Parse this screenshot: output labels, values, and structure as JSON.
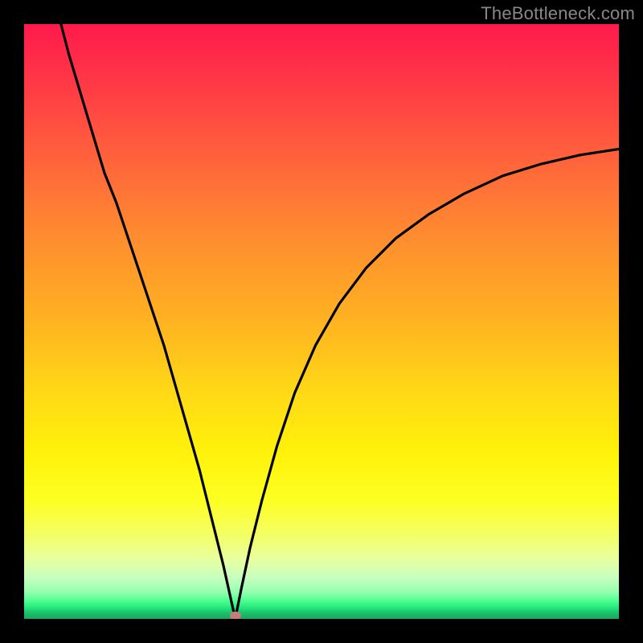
{
  "attribution": "TheBottleneck.com",
  "colors": {
    "page_bg": "#000000",
    "curve_stroke": "#000000",
    "marker": "#c77b7b",
    "gradient_stops": [
      {
        "pos": 0,
        "color": "#ff1a4b"
      },
      {
        "pos": 0.08,
        "color": "#ff3247"
      },
      {
        "pos": 0.2,
        "color": "#ff5a3e"
      },
      {
        "pos": 0.35,
        "color": "#ff8a30"
      },
      {
        "pos": 0.5,
        "color": "#ffb321"
      },
      {
        "pos": 0.62,
        "color": "#ffd916"
      },
      {
        "pos": 0.72,
        "color": "#fff20a"
      },
      {
        "pos": 0.8,
        "color": "#fdff22"
      },
      {
        "pos": 0.86,
        "color": "#f4ff66"
      },
      {
        "pos": 0.9,
        "color": "#e8ffa0"
      },
      {
        "pos": 0.93,
        "color": "#c8ffbf"
      },
      {
        "pos": 0.955,
        "color": "#95ffb0"
      },
      {
        "pos": 0.97,
        "color": "#4cff8f"
      },
      {
        "pos": 0.982,
        "color": "#22e57a"
      },
      {
        "pos": 0.99,
        "color": "#1dbf6c"
      },
      {
        "pos": 1.0,
        "color": "#18a85f"
      }
    ]
  },
  "chart_data": {
    "type": "line",
    "title": "",
    "xlabel": "",
    "ylabel": "",
    "grid": false,
    "legend": false,
    "x_range": [
      0,
      1
    ],
    "y_range": [
      0,
      1
    ],
    "minimum_point": {
      "x": 0.355,
      "y": 0.0
    },
    "curve_points": [
      {
        "x": 0.062,
        "y": 1.0
      },
      {
        "x": 0.075,
        "y": 0.95
      },
      {
        "x": 0.09,
        "y": 0.9
      },
      {
        "x": 0.105,
        "y": 0.85
      },
      {
        "x": 0.12,
        "y": 0.8
      },
      {
        "x": 0.135,
        "y": 0.75
      },
      {
        "x": 0.155,
        "y": 0.7
      },
      {
        "x": 0.175,
        "y": 0.64
      },
      {
        "x": 0.195,
        "y": 0.58
      },
      {
        "x": 0.215,
        "y": 0.52
      },
      {
        "x": 0.235,
        "y": 0.46
      },
      {
        "x": 0.255,
        "y": 0.39
      },
      {
        "x": 0.275,
        "y": 0.32
      },
      {
        "x": 0.295,
        "y": 0.25
      },
      {
        "x": 0.315,
        "y": 0.17
      },
      {
        "x": 0.335,
        "y": 0.09
      },
      {
        "x": 0.355,
        "y": 0.0
      },
      {
        "x": 0.365,
        "y": 0.05
      },
      {
        "x": 0.38,
        "y": 0.12
      },
      {
        "x": 0.4,
        "y": 0.2
      },
      {
        "x": 0.425,
        "y": 0.29
      },
      {
        "x": 0.455,
        "y": 0.38
      },
      {
        "x": 0.49,
        "y": 0.46
      },
      {
        "x": 0.53,
        "y": 0.53
      },
      {
        "x": 0.575,
        "y": 0.59
      },
      {
        "x": 0.625,
        "y": 0.64
      },
      {
        "x": 0.68,
        "y": 0.68
      },
      {
        "x": 0.74,
        "y": 0.715
      },
      {
        "x": 0.805,
        "y": 0.745
      },
      {
        "x": 0.87,
        "y": 0.765
      },
      {
        "x": 0.935,
        "y": 0.78
      },
      {
        "x": 1.0,
        "y": 0.79
      }
    ],
    "marker": {
      "x": 0.355,
      "y": 0.005,
      "color": "#c77b7b"
    }
  }
}
